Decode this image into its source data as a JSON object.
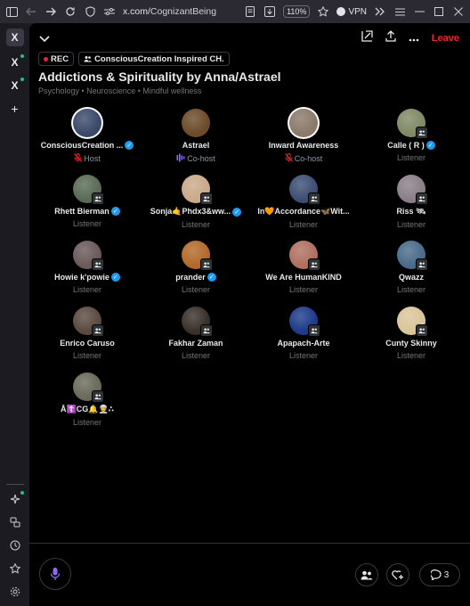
{
  "browser": {
    "url_domain": "x.com/",
    "url_path": "CognizantBeing",
    "zoom": "110%",
    "vpn_label": "VPN"
  },
  "rail": {
    "logo_label": "X",
    "tab1_label": "X",
    "tab2_label": "X",
    "add_label": "+"
  },
  "space": {
    "leave_label": "Leave",
    "rec_label": "REC",
    "community_label": "ConsciousCreation Inspired CH.",
    "title": "Addictions & Spirituality by Anna/Astrael",
    "topics": "Psychology • Neuroscience • Mindful wellness"
  },
  "participants": [
    {
      "name": "ConsciousCreation ...",
      "role": "Host",
      "verified": true,
      "avatar_color": "#3b4a6b"
    },
    {
      "name": "Astrael",
      "role": "Co-host",
      "verified": false,
      "avatar_color": "#6b4b2a"
    },
    {
      "name": "Inward Awareness",
      "role": "Co-host",
      "verified": false,
      "avatar_color": "#8a7a6a"
    },
    {
      "name": "Calle ( R )",
      "role": "Listener",
      "verified": true,
      "avatar_color": "#7f8a66"
    },
    {
      "name": "Rhett Bierman",
      "role": "Listener",
      "verified": true,
      "avatar_color": "#5a6a55"
    },
    {
      "name": "Sonja🤙Phdx3&ww...",
      "role": "Listener",
      "verified": true,
      "avatar_color": "#c9a98a"
    },
    {
      "name": "In🧡Accordance🦋Wit...",
      "role": "Listener",
      "verified": false,
      "avatar_color": "#3c4e73"
    },
    {
      "name": "Riss 🛰",
      "role": "Listener",
      "verified": false,
      "avatar_color": "#8a7f88"
    },
    {
      "name": "Howie k'powie",
      "role": "Listener",
      "verified": true,
      "avatar_color": "#6a5a5a"
    },
    {
      "name": "prander",
      "role": "Listener",
      "verified": true,
      "avatar_color": "#b26a2a"
    },
    {
      "name": "We Are HumanKIND",
      "role": "Listener",
      "verified": false,
      "avatar_color": "#b07060"
    },
    {
      "name": "Qwazz",
      "role": "Listener",
      "verified": false,
      "avatar_color": "#4a6b8a"
    },
    {
      "name": "Enrico Caruso",
      "role": "Listener",
      "verified": false,
      "avatar_color": "#5a4a40"
    },
    {
      "name": "Fakhar Zaman",
      "role": "Listener",
      "verified": false,
      "avatar_color": "#3a302a"
    },
    {
      "name": "Apapach-Arte",
      "role": "Listener",
      "verified": false,
      "avatar_color": "#1e3b8a"
    },
    {
      "name": "Cunty Skinny",
      "role": "Listener",
      "verified": false,
      "avatar_color": "#d9c59a"
    },
    {
      "name": "Å☦️CG🔔👳‍♀️∴",
      "role": "Listener",
      "verified": false,
      "avatar_color": "#6a6a5a"
    }
  ],
  "footer": {
    "comments_count": "3"
  }
}
